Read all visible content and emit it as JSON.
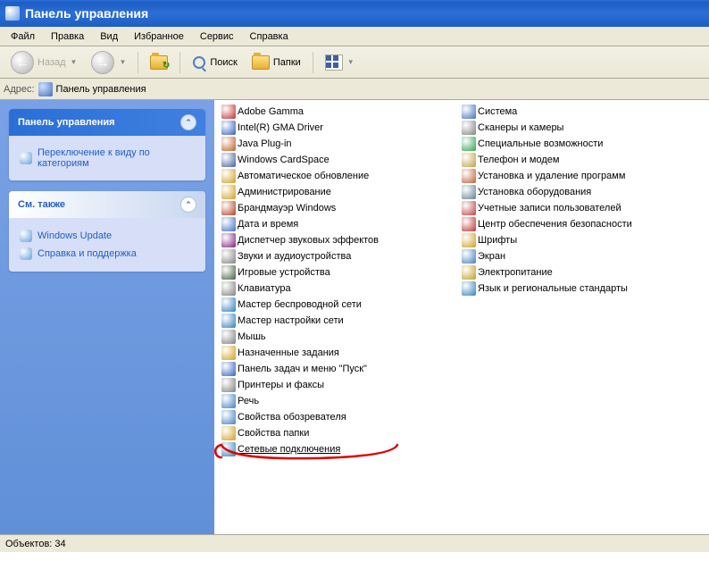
{
  "window_title": "Панель управления",
  "menu": [
    "Файл",
    "Правка",
    "Вид",
    "Избранное",
    "Сервис",
    "Справка"
  ],
  "toolbar": {
    "back": "Назад",
    "search": "Поиск",
    "folders": "Папки"
  },
  "address": {
    "label": "Адрес:",
    "value": "Панель управления"
  },
  "sidebar": {
    "panels": [
      {
        "title": "Панель управления",
        "dark": true,
        "items": [
          {
            "label": "Переключение к виду по категориям"
          }
        ]
      },
      {
        "title": "См. также",
        "dark": false,
        "items": [
          {
            "label": "Windows Update"
          },
          {
            "label": "Справка и поддержка"
          }
        ]
      }
    ]
  },
  "columns": [
    [
      {
        "label": "Adobe Gamma",
        "color": "#c03030"
      },
      {
        "label": "Intel(R) GMA Driver",
        "color": "#3060c0"
      },
      {
        "label": "Java Plug-in",
        "color": "#c06020"
      },
      {
        "label": "Windows CardSpace",
        "color": "#4060a0"
      },
      {
        "label": "Автоматическое обновление",
        "color": "#d0a020"
      },
      {
        "label": "Администрирование",
        "color": "#d0a020"
      },
      {
        "label": "Брандмауэр Windows",
        "color": "#b04020"
      },
      {
        "label": "Дата и время",
        "color": "#4070c0"
      },
      {
        "label": "Диспетчер звуковых эффектов",
        "color": "#802080"
      },
      {
        "label": "Звуки и аудиоустройства",
        "color": "#808080"
      },
      {
        "label": "Игровые устройства",
        "color": "#406040"
      },
      {
        "label": "Клавиатура",
        "color": "#808080"
      },
      {
        "label": "Мастер беспроводной сети",
        "color": "#3080c0"
      },
      {
        "label": "Мастер настройки сети",
        "color": "#3080c0"
      },
      {
        "label": "Мышь",
        "color": "#808080"
      },
      {
        "label": "Назначенные задания",
        "color": "#d0a020"
      },
      {
        "label": "Панель задач и меню \"Пуск\"",
        "color": "#3060c0"
      },
      {
        "label": "Принтеры и факсы",
        "color": "#808080"
      },
      {
        "label": "Речь",
        "color": "#4080c0"
      },
      {
        "label": "Свойства обозревателя",
        "color": "#4080c0"
      },
      {
        "label": "Свойства папки",
        "color": "#d0a020"
      },
      {
        "label": "Сетевые подключения",
        "color": "#3080c0",
        "highlighted": true
      }
    ],
    [
      {
        "label": "Система",
        "color": "#4070c0"
      },
      {
        "label": "Сканеры и камеры",
        "color": "#808080"
      },
      {
        "label": "Специальные возможности",
        "color": "#30a050"
      },
      {
        "label": "Телефон и модем",
        "color": "#c0a040"
      },
      {
        "label": "Установка и удаление программ",
        "color": "#c06030"
      },
      {
        "label": "Установка оборудования",
        "color": "#608090"
      },
      {
        "label": "Учетные записи пользователей",
        "color": "#c04040"
      },
      {
        "label": "Центр обеспечения безопасности",
        "color": "#c03030"
      },
      {
        "label": "Шрифты",
        "color": "#d0a020"
      },
      {
        "label": "Экран",
        "color": "#4080c0"
      },
      {
        "label": "Электропитание",
        "color": "#c0a020"
      },
      {
        "label": "Язык и региональные стандарты",
        "color": "#3080c0"
      }
    ]
  ],
  "statusbar": {
    "objects_label": "Объектов:",
    "objects_count": "34"
  }
}
